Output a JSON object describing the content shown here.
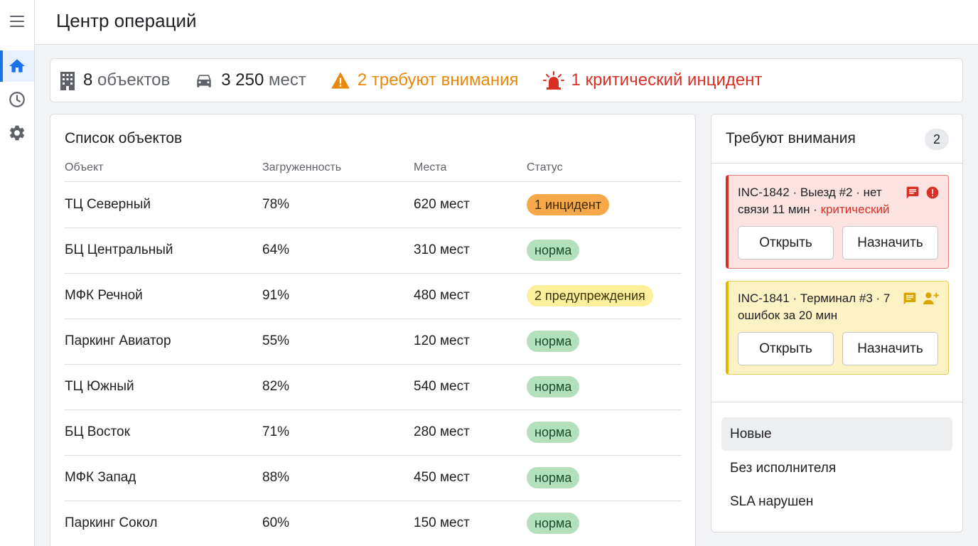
{
  "header": {
    "title": "Центр операций"
  },
  "summary": {
    "objects_count": "8",
    "objects_label": "объектов",
    "spaces_count": "3 250",
    "spaces_label": "мест",
    "attention_text": "2 требуют внимания",
    "critical_text": "1 критический инцидент",
    "icons": [
      "building-icon",
      "car-icon",
      "warning-icon",
      "siren-icon"
    ]
  },
  "objects": {
    "title": "Список объектов",
    "columns": [
      "Объект",
      "Загруженность",
      "Места",
      "Статус"
    ],
    "rows": [
      {
        "name": "ТЦ Северный",
        "load": "78%",
        "spaces": "620 мест",
        "status": "1 инцидент",
        "status_type": "orange"
      },
      {
        "name": "БЦ Центральный",
        "load": "64%",
        "spaces": "310 мест",
        "status": "норма",
        "status_type": "green"
      },
      {
        "name": "МФК Речной",
        "load": "91%",
        "spaces": "480 мест",
        "status": "2 предупреждения",
        "status_type": "yellow"
      },
      {
        "name": "Паркинг Авиатор",
        "load": "55%",
        "spaces": "120 мест",
        "status": "норма",
        "status_type": "green"
      },
      {
        "name": "ТЦ Южный",
        "load": "82%",
        "spaces": "540 мест",
        "status": "норма",
        "status_type": "green"
      },
      {
        "name": "БЦ Восток",
        "load": "71%",
        "spaces": "280 мест",
        "status": "норма",
        "status_type": "green"
      },
      {
        "name": "МФК Запад",
        "load": "88%",
        "spaces": "450 мест",
        "status": "норма",
        "status_type": "green"
      },
      {
        "name": "Паркинг Сокол",
        "load": "60%",
        "spaces": "150 мест",
        "status": "норма",
        "status_type": "green"
      }
    ]
  },
  "attention": {
    "title": "Требуют внимания",
    "count": "2",
    "incidents": [
      {
        "text": "INC-1842 · Выезд #2 · нет связи 11 мин · ",
        "severity": "критический",
        "icons": [
          "comment-icon",
          "error-icon"
        ],
        "open_label": "Открыть",
        "assign_label": "Назначить"
      },
      {
        "text": "INC-1841 · Терминал #3 · 7 ошибок за 20 мин",
        "severity": "",
        "icons": [
          "comment-icon",
          "assign-person-icon"
        ],
        "open_label": "Открыть",
        "assign_label": "Назначить"
      }
    ],
    "filters": [
      "Новые",
      "Без исполнителя",
      "SLA нарушен"
    ],
    "selected_filter": "Новые"
  },
  "colors": {
    "accent": "#1a73e8",
    "warning": "#e8890c",
    "critical": "#d93025",
    "status_orange": "#f7a84a",
    "status_yellow": "#fdef9b",
    "status_green": "#b3e0bd"
  }
}
